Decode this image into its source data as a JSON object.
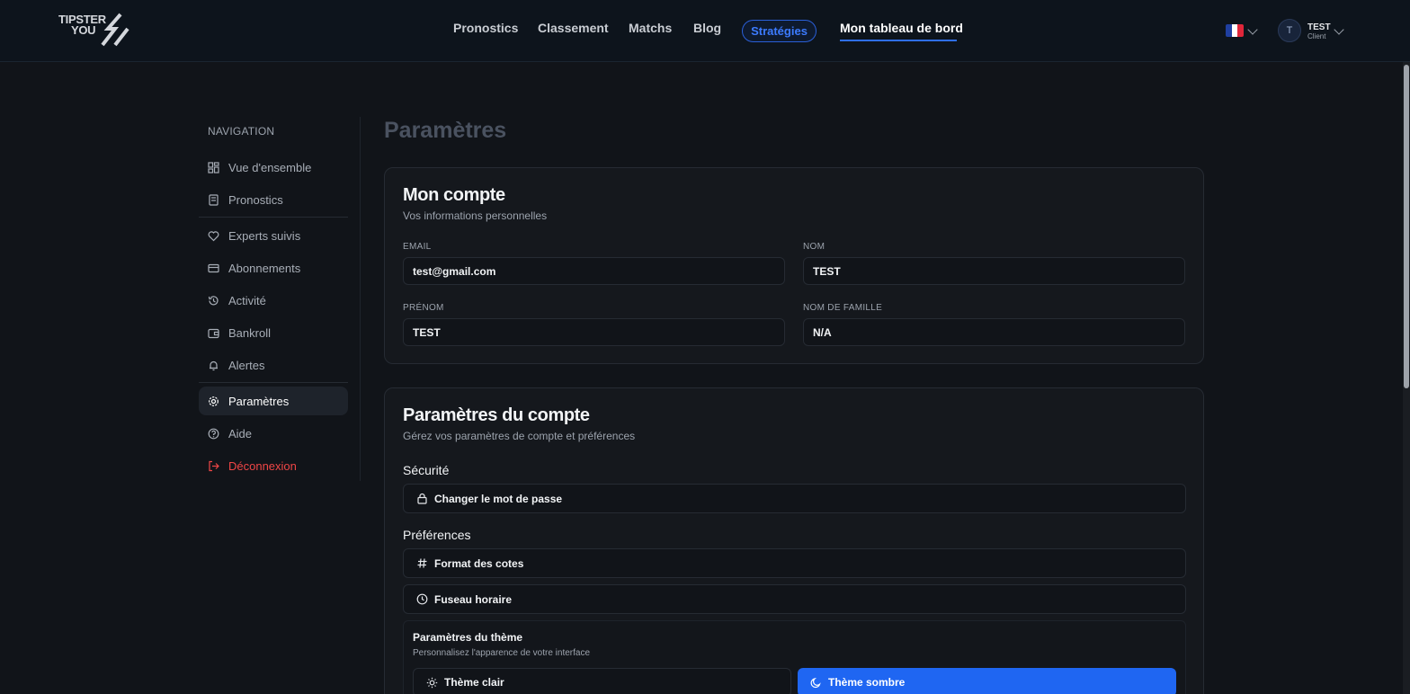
{
  "header": {
    "logo_line1": "TIPSTER",
    "logo_line2": "YOU",
    "nav": [
      {
        "label": "Pronostics"
      },
      {
        "label": "Classement"
      },
      {
        "label": "Matchs"
      },
      {
        "label": "Blog"
      }
    ],
    "strategies_label": "Stratégies",
    "dashboard_label": "Mon tableau de bord",
    "language_flag": "fr-flag-icon",
    "user": {
      "initial": "T",
      "name": "TEST",
      "role": "Client"
    }
  },
  "sidebar": {
    "title": "NAVIGATION",
    "items": [
      {
        "label": "Vue d'ensemble",
        "icon": "grid-icon"
      },
      {
        "label": "Pronostics",
        "icon": "scroll-icon"
      },
      {
        "label": "Experts suivis",
        "icon": "heart-icon"
      },
      {
        "label": "Abonnements",
        "icon": "credit-card-icon"
      },
      {
        "label": "Activité",
        "icon": "history-icon"
      },
      {
        "label": "Bankroll",
        "icon": "wallet-icon"
      },
      {
        "label": "Alertes",
        "icon": "bell-icon"
      },
      {
        "label": "Paramètres",
        "icon": "gear-icon",
        "active": true
      },
      {
        "label": "Aide",
        "icon": "help-circle-icon"
      },
      {
        "label": "Déconnexion",
        "icon": "logout-icon"
      }
    ]
  },
  "page": {
    "title": "Paramètres"
  },
  "account": {
    "title": "Mon compte",
    "subtitle": "Vos informations personnelles",
    "fields": {
      "email": {
        "label": "EMAIL",
        "value": "test@gmail.com"
      },
      "nom": {
        "label": "NOM",
        "value": "TEST"
      },
      "prenom": {
        "label": "PRÉNOM",
        "value": "TEST"
      },
      "nom_famille": {
        "label": "NOM DE FAMILLE",
        "value": "N/A"
      }
    }
  },
  "settings": {
    "title": "Paramètres du compte",
    "subtitle": "Gérez vos paramètres de compte et préférences",
    "security_title": "Sécurité",
    "change_password": "Changer le mot de passe",
    "preferences_title": "Préférences",
    "odds_format": "Format des cotes",
    "timezone": "Fuseau horaire",
    "theme": {
      "title": "Paramètres du thème",
      "subtitle": "Personnalisez l'apparence de votre interface",
      "light": "Thème clair",
      "dark": "Thème sombre",
      "selected": "dark"
    }
  },
  "colors": {
    "accent": "#1f66f2",
    "danger": "#f04646",
    "background": "#111419"
  }
}
